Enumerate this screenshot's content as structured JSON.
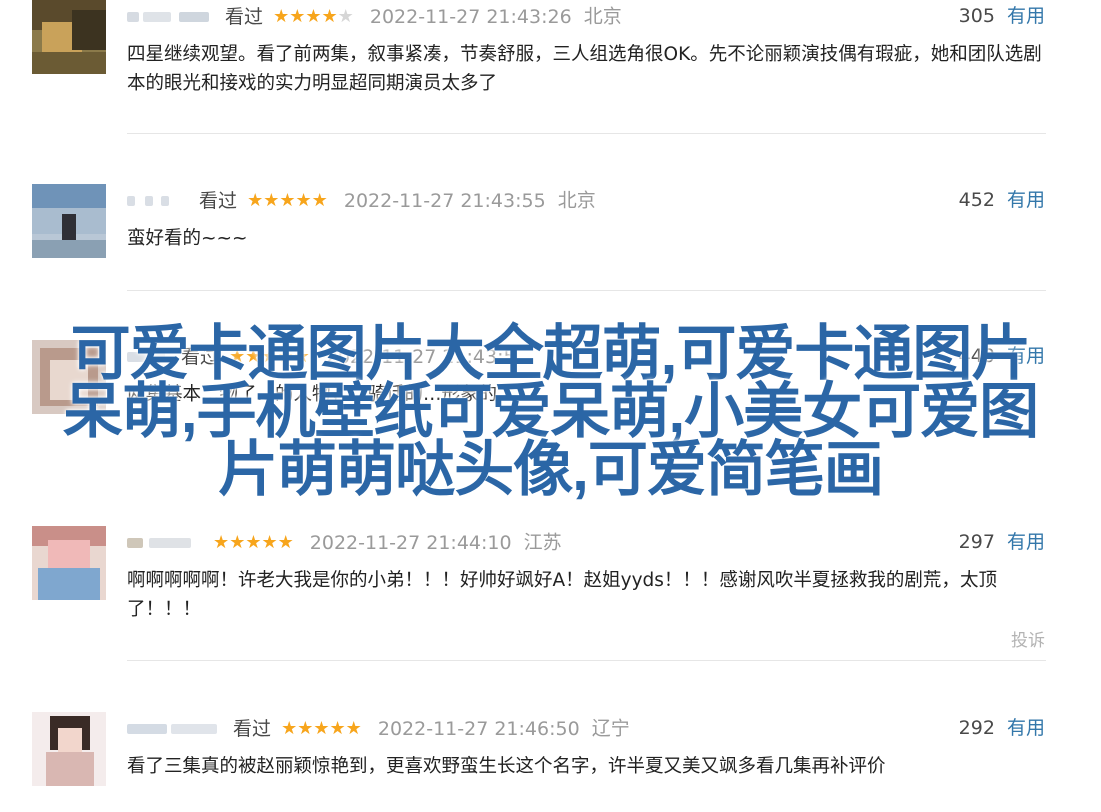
{
  "reviews": [
    {
      "status": "看过",
      "stars": 4,
      "time": "2022-11-27 21:43:26",
      "location": "北京",
      "votes": "305",
      "useful_label": "有用",
      "content": "四星继续观望。看了前两集，叙事紧凑，节奏舒服，三人组选角很OK。先不论丽颖演技偶有瑕疵，她和团队选剧本的眼光和接戏的实力明显超同期演员太多了"
    },
    {
      "status": "看过",
      "stars": 5,
      "time": "2022-11-27 21:43:55",
      "location": "北京",
      "votes": "452",
      "useful_label": "有用",
      "content": "蛮好看的~~~"
    },
    {
      "status": "看过",
      "stars": 5,
      "time": "2022-11-27 21:43:5",
      "location": "",
      "votes": "440",
      "useful_label": "有用",
      "content": "两集基本…物了…的人物，…骑话的…形象的…"
    },
    {
      "status": "",
      "stars": 5,
      "time": "2022-11-27 21:44:10",
      "location": "江苏",
      "votes": "297",
      "useful_label": "有用",
      "content": "啊啊啊啊啊！许老大我是你的小弟！！！好帅好飒好A！赵姐yyds！！！感谢风吹半夏拯救我的剧荒，太顶了！！！",
      "report": "投诉"
    },
    {
      "status": "看过",
      "stars": 5,
      "time": "2022-11-27 21:46:50",
      "location": "辽宁",
      "votes": "292",
      "useful_label": "有用",
      "content": "看了三集真的被赵丽颖惊艳到，更喜欢野蛮生长这个名字，许半夏又美又飒多看几集再补评价"
    }
  ],
  "overlay": {
    "line1": "可爱卡通图片大全超萌,可爱卡通图片",
    "line2": "呆萌,手机壁纸可爱呆萌,小美女可爱图",
    "line3": "片萌萌哒头像,可爱简笔画",
    "color": "#2b66a6"
  },
  "colors": {
    "star": "#f7a51c",
    "link": "#3377aa",
    "muted": "#9a9a9a"
  }
}
